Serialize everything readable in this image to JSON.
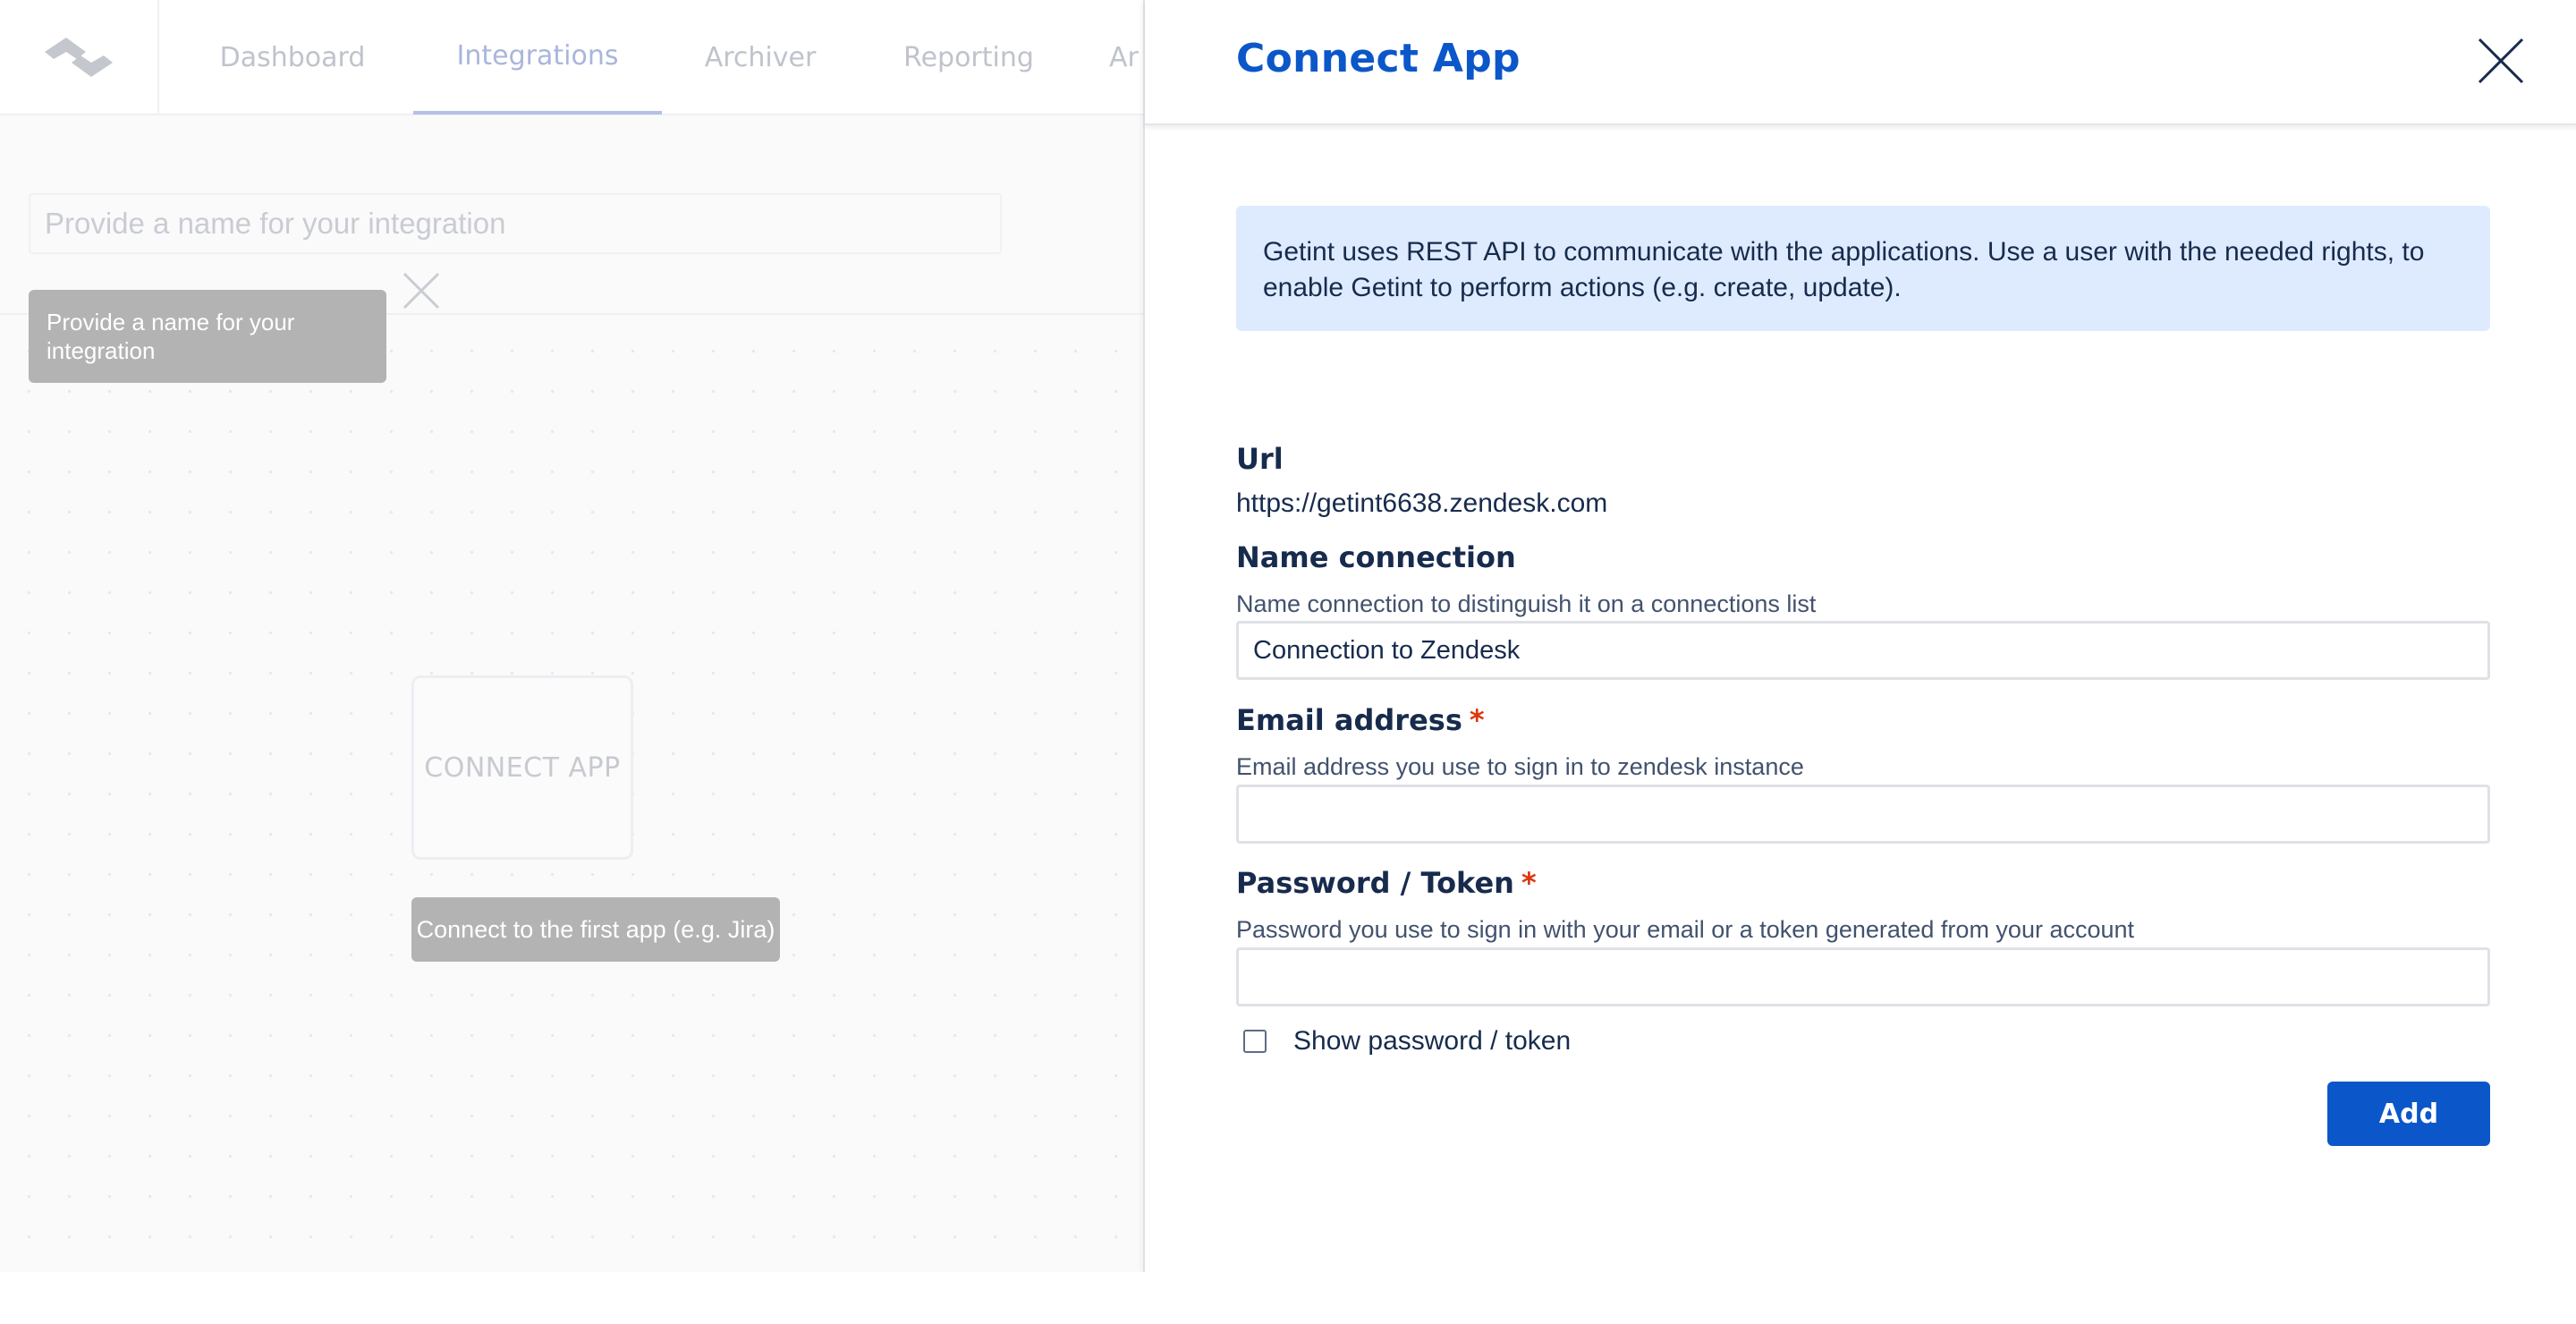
{
  "nav": {
    "items": [
      {
        "label": "Dashboard"
      },
      {
        "label": "Integrations",
        "active": true
      },
      {
        "label": "Archiver"
      },
      {
        "label": "Reporting"
      },
      {
        "label": "Ar"
      }
    ]
  },
  "integration": {
    "name_placeholder": "Provide a name for your integration",
    "name_tooltip": "Provide a name for your integration",
    "connect_card_label": "CONNECT APP",
    "connect_tooltip": "Connect to the first app (e.g. Jira)"
  },
  "drawer": {
    "title": "Connect App",
    "info": "Getint uses REST API to communicate with the applications. Use a user with the needed rights, to enable Getint to perform actions (e.g. create, update).",
    "url": {
      "label": "Url",
      "value": "https://getint6638.zendesk.com"
    },
    "name_connection": {
      "label": "Name connection",
      "description": "Name connection to distinguish it on a connections list",
      "value": "Connection to Zendesk"
    },
    "email": {
      "label": "Email address",
      "required_mark": "*",
      "description": "Email address you use to sign in to zendesk instance",
      "value": ""
    },
    "password": {
      "label": "Password / Token",
      "required_mark": "*",
      "description": "Password you use to sign in with your email or a token generated from your account",
      "value": ""
    },
    "show_password_label": "Show password / token",
    "show_password_checked": false,
    "add_label": "Add"
  },
  "colors": {
    "accent": "#0b57c9",
    "info_background": "#deebff",
    "required": "#de350b",
    "tooltip": "#b3b3b3"
  },
  "icons": [
    "getint-logo-icon",
    "close-icon",
    "checkbox-icon"
  ]
}
